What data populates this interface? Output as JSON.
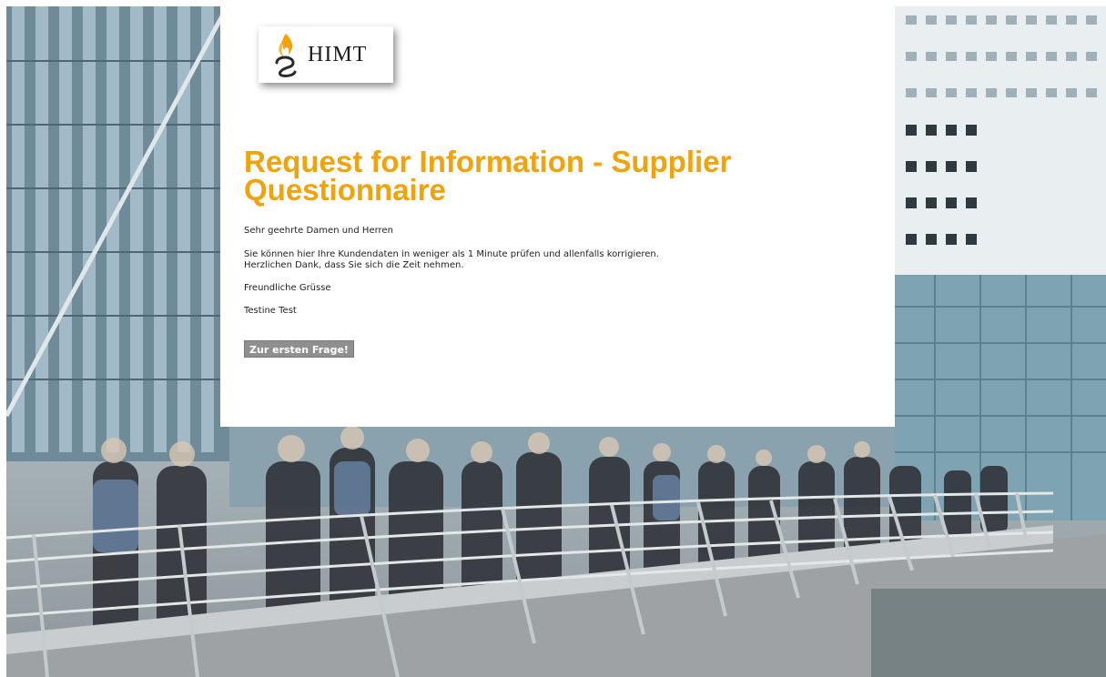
{
  "logo": {
    "text": "HIMT",
    "accent_color": "#f2a20a"
  },
  "content": {
    "title": "Request for Information - Supplier Questionnaire",
    "greeting": "Sehr geehrte Damen und Herren",
    "body_line1": "Sie können hier Ihre Kundendaten in weniger als 1 Minute prüfen und allenfalls korrigieren.",
    "body_line2": "Herzlichen Dank, dass Sie sich die Zeit nehmen.",
    "closing": "Freundliche Grüsse",
    "signature": "Testine Test",
    "start_button_label": "Zur ersten Frage!"
  },
  "colors": {
    "title": "#f2a20a",
    "button": "#8f8f8f"
  }
}
